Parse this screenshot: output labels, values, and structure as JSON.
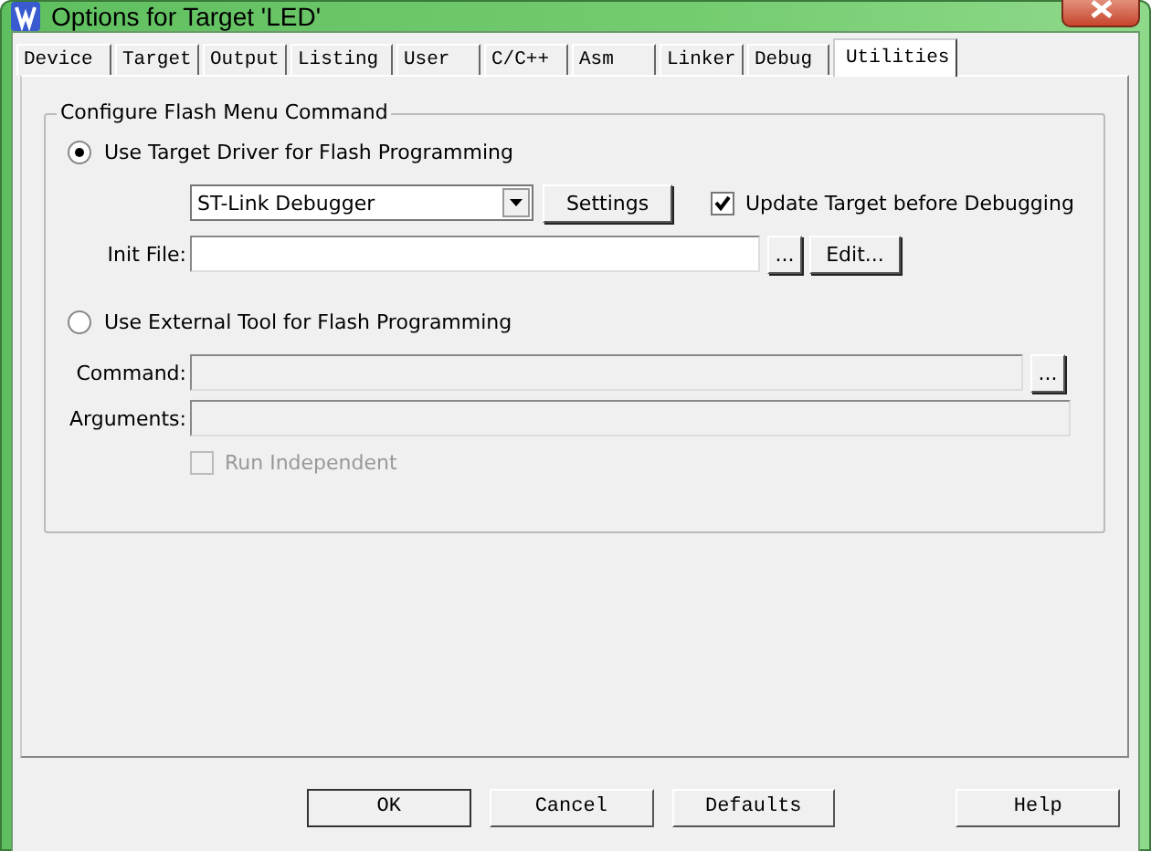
{
  "window": {
    "title": "Options for Target 'LED'"
  },
  "tabs": [
    {
      "label": "Device",
      "selected": false
    },
    {
      "label": "Target",
      "selected": false
    },
    {
      "label": "Output",
      "selected": false
    },
    {
      "label": "Listing",
      "selected": false
    },
    {
      "label": "User",
      "selected": false
    },
    {
      "label": "C/C++",
      "selected": false
    },
    {
      "label": "Asm",
      "selected": false
    },
    {
      "label": "Linker",
      "selected": false
    },
    {
      "label": "Debug",
      "selected": false
    },
    {
      "label": "Utilities",
      "selected": true
    }
  ],
  "group": {
    "title": "Configure Flash Menu Command",
    "target_driver": {
      "label": "Use Target Driver for Flash Programming",
      "selected": true
    },
    "driver": {
      "value": "ST-Link Debugger"
    },
    "settings_button": "Settings",
    "update_target": {
      "label": "Update Target before Debugging",
      "checked": true
    },
    "init_file": {
      "label": "Init File:",
      "browse": "...",
      "edit": "Edit..."
    },
    "external_tool": {
      "label": "Use External Tool for Flash Programming",
      "selected": false
    },
    "command": {
      "label": "Command:",
      "disabled": true,
      "browse": "..."
    },
    "arguments": {
      "label": "Arguments:",
      "disabled": true
    },
    "run_independent": {
      "label": "Run Independent",
      "checked": false,
      "disabled": true
    }
  },
  "buttons": [
    "OK",
    "Cancel",
    "Defaults",
    "Help"
  ]
}
